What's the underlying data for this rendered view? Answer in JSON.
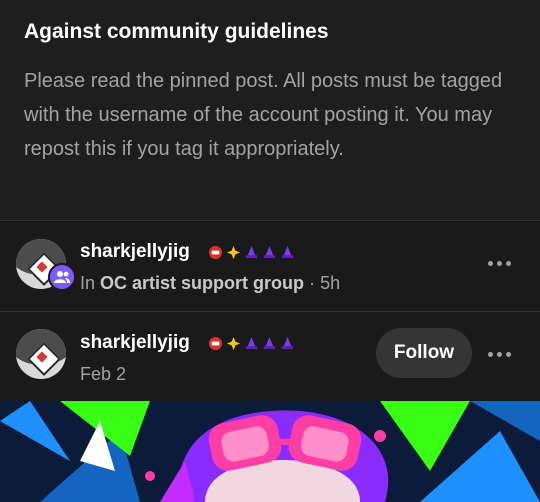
{
  "notice": {
    "title": "Against community guidelines",
    "body": "Please read the pinned post. All posts must be tagged with the username of the account posting it. You may repost this if you tag it appropriately."
  },
  "reblog": {
    "username": "sharkjellyjig",
    "prefix": "In",
    "group": "OC artist support group",
    "separator": "·",
    "age": "5h",
    "more_icon": "more-dots-icon",
    "group_icon": "group-people-icon"
  },
  "original": {
    "username": "sharkjellyjig",
    "date": "Feb 2",
    "follow_label": "Follow",
    "more_icon": "more-dots-icon"
  },
  "badge_icons": [
    "red-medal-badge-icon",
    "yellow-sparkle-badge-icon",
    "purple-witch-badge-icon",
    "purple-witch-badge-icon",
    "purple-witch-badge-icon"
  ],
  "colors": {
    "background": "#1a1a1a",
    "muted_text": "#a3a3a3",
    "group_badge": "#7c5cff",
    "follow_button": "#353535",
    "art_pink": "#ff3ea5",
    "art_purple": "#8a2cff",
    "art_green": "#39ff14",
    "art_blue": "#1e90ff"
  }
}
